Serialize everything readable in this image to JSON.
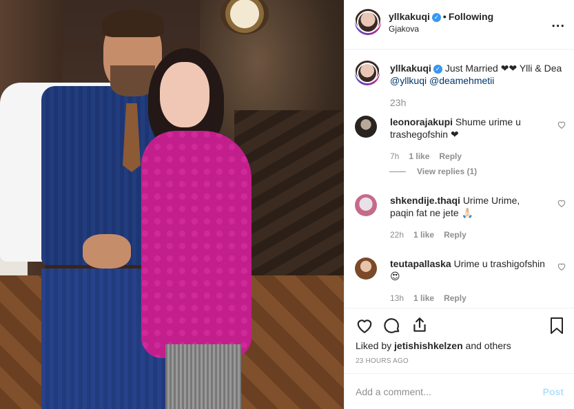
{
  "post_header": {
    "username": "yllkakuqi",
    "separator": "•",
    "follow_state": "Following",
    "location": "Gjakova",
    "more_glyph": "..."
  },
  "caption": {
    "username": "yllkakuqi",
    "text": "Just Married ❤❤ Ylli & Dea",
    "mentions": [
      "@yllkuqi",
      "@deamehmetii"
    ],
    "time": "23h"
  },
  "comments": [
    {
      "username": "leonorajakupi",
      "text": "Shume urime u trashegofshin ❤",
      "time": "7h",
      "likes": "1 like",
      "reply": "Reply",
      "view_replies": "View replies (1)"
    },
    {
      "username": "shkendije.thaqi",
      "text": "Urime Urime, paqin fat ne jete 🙏🏻",
      "time": "22h",
      "likes": "1 like",
      "reply": "Reply"
    },
    {
      "username": "teutapallaska",
      "text": "Urime u trashigofshin 😍",
      "time": "13h",
      "likes": "1 like",
      "reply": "Reply"
    }
  ],
  "actions": {
    "icons": [
      "heart-icon",
      "comment-icon",
      "share-icon",
      "bookmark-icon"
    ],
    "liked_by_prefix": "Liked by",
    "liked_by_user": "jetishishkelzen",
    "liked_by_suffix": "and others",
    "posted_ago": "23 HOURS AGO"
  },
  "add_comment": {
    "placeholder": "Add a comment...",
    "post_label": "Post"
  },
  "colors": {
    "verified": "#3897f0",
    "link": "#003569",
    "muted": "#8e8e8e",
    "post_disabled": "#b2dffc"
  }
}
